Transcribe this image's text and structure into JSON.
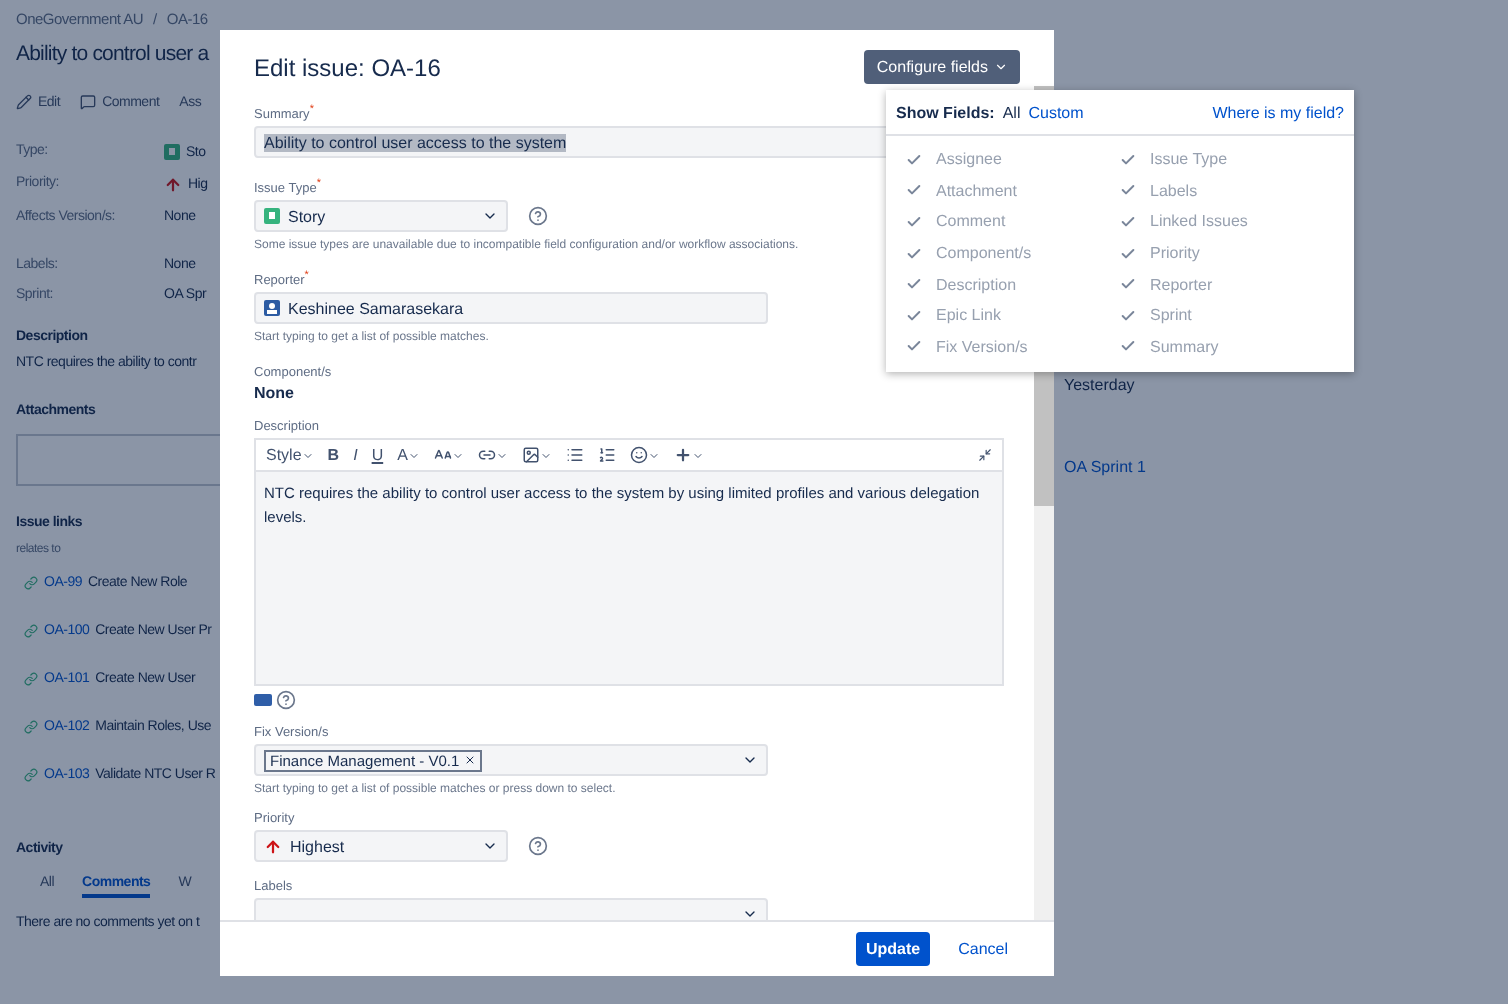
{
  "page": {
    "breadcrumbs": [
      "OneGovernment AU",
      "OA-16"
    ],
    "separator": "/",
    "title": "Ability to control user a",
    "actions": [
      {
        "label": "Edit",
        "kind": "edit"
      },
      {
        "label": "Comment",
        "kind": "comment"
      },
      {
        "label": "Ass",
        "kind": "plain"
      }
    ],
    "detail_groups": [
      [
        {
          "label": "Type:",
          "value": "Sto",
          "kind": "type"
        },
        {
          "label": "Priority:",
          "value": "Hig",
          "kind": "priority"
        },
        {
          "label": "Affects Version/s:",
          "value": "None",
          "kind": "text"
        }
      ],
      [
        {
          "label": "Labels:",
          "value": "None",
          "kind": "text"
        },
        {
          "label": "Sprint:",
          "value": "OA Spr",
          "kind": "text"
        }
      ]
    ],
    "description": {
      "heading": "Description",
      "text": "NTC requires the ability to contr"
    },
    "attachments": {
      "heading": "Attachments"
    },
    "issue_links": {
      "heading": "Issue links",
      "relation": "relates to",
      "links": [
        {
          "key": "OA-99",
          "title": "Create New Role"
        },
        {
          "key": "OA-100",
          "title": "Create New User Pr"
        },
        {
          "key": "OA-101",
          "title": "Create New User"
        },
        {
          "key": "OA-102",
          "title": "Maintain Roles, Use"
        },
        {
          "key": "OA-103",
          "title": "Validate NTC User R"
        }
      ]
    },
    "activity": {
      "heading": "Activity",
      "tabs": [
        {
          "label": "All",
          "selected": false
        },
        {
          "label": "Comments",
          "selected": true
        },
        {
          "label": "W",
          "selected": false
        }
      ],
      "empty_text": "There are no comments yet on t"
    },
    "side": {
      "updated": "Yesterday",
      "sprint": "OA Sprint 1"
    }
  },
  "dialog": {
    "title": "Edit issue: OA-16",
    "configure_button": "Configure fields",
    "fields": [
      {
        "kind": "text",
        "label": "Summary$^{*}$",
        "value": "Ability to control user access to the system",
        "text_selected": true
      },
      {
        "kind": "issue_type_select",
        "label": "Issue Type$^{*}$",
        "value": "Story",
        "help": true,
        "hint": "Some issue types are unavailable due to incompatible field configuration and/or workflow associations."
      },
      {
        "kind": "user",
        "label": "Reporter$^{*}$",
        "value": "Keshinee Samarasekara",
        "hint": "Start typing to get a list of possible matches."
      },
      {
        "kind": "static",
        "label": "Component/s",
        "value": "None"
      },
      {
        "kind": "editor",
        "label": "Description",
        "value": "NTC requires the ability to control user access to the system by using limited profiles and various delegation levels.",
        "toolbar": [
          {
            "kind": "menu",
            "label": "Style"
          },
          {
            "kind": "bold",
            "label": "B"
          },
          {
            "kind": "italic",
            "label": "I"
          },
          {
            "kind": "underline",
            "label": "U"
          },
          {
            "kind": "color",
            "label": "A"
          },
          {
            "kind": "size"
          },
          {
            "kind": "link"
          },
          {
            "kind": "image"
          },
          {
            "kind": "bullets"
          },
          {
            "kind": "numbers"
          },
          {
            "kind": "emoji"
          },
          {
            "kind": "insert"
          }
        ]
      },
      {
        "kind": "multiselect",
        "label": "Fix Version/s",
        "tags": [
          "Finance Management - V0.1"
        ],
        "hint": "Start typing to get a list of possible matches or press down to select."
      },
      {
        "kind": "priority_select",
        "label": "Priority",
        "value": "Highest",
        "help": true
      },
      {
        "kind": "multiselect",
        "label": "Labels"
      }
    ],
    "buttons": [
      {
        "label": "Update",
        "kind": "primary"
      },
      {
        "label": "Cancel",
        "kind": "link"
      }
    ]
  },
  "configure_popup": {
    "show_label": "Show Fields:",
    "options": [
      {
        "label": "All",
        "selected": true
      },
      {
        "label": "Custom",
        "selected": false
      }
    ],
    "help_link": "Where is my field?",
    "fields": [
      {
        "label": "Assignee",
        "checked": true
      },
      {
        "label": "Attachment",
        "checked": true
      },
      {
        "label": "Comment",
        "checked": true
      },
      {
        "label": "Component/s",
        "checked": true
      },
      {
        "label": "Description",
        "checked": true
      },
      {
        "label": "Epic Link",
        "checked": true
      },
      {
        "label": "Fix Version/s",
        "checked": true
      },
      {
        "label": "Issue Type",
        "checked": true
      },
      {
        "label": "Labels",
        "checked": true
      },
      {
        "label": "Linked Issues",
        "checked": true
      },
      {
        "label": "Priority",
        "checked": true
      },
      {
        "label": "Reporter",
        "checked": true
      },
      {
        "label": "Sprint",
        "checked": true
      },
      {
        "label": "Summary",
        "checked": true
      }
    ]
  }
}
